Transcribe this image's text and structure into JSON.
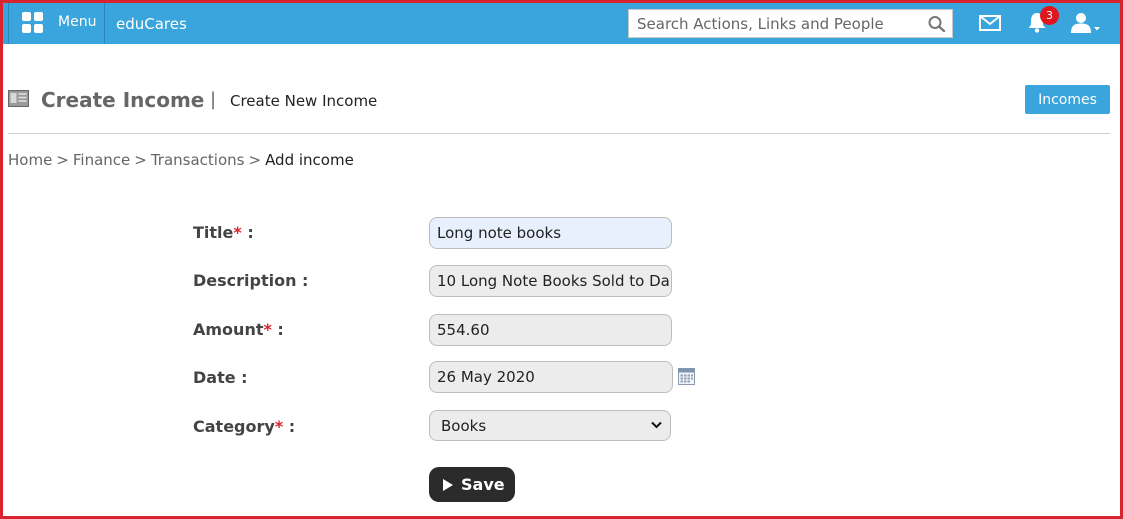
{
  "app": {
    "menu_label": "Menu",
    "brand": "eduCares",
    "search_placeholder": "Search Actions, Links and People",
    "notification_count": "3",
    "accent_color": "#3aa4dc",
    "badge_color": "#e0161d",
    "icons": [
      "menu-grid-icon",
      "search-icon",
      "mail-icon",
      "bell-icon",
      "user-icon",
      "chevron-down-icon",
      "receipt-icon",
      "calendar-icon",
      "play-icon"
    ]
  },
  "header": {
    "title": "Create Income",
    "separator": "|",
    "subtitle": "Create New Income",
    "incomes_button": "Incomes"
  },
  "breadcrumb": {
    "items": [
      "Home",
      "Finance",
      "Transactions"
    ],
    "current": "Add income",
    "separator": ">"
  },
  "form": {
    "required_mark": "*",
    "title_label": "Title",
    "title_value": "Long note books",
    "description_label": "Description :",
    "description_value": "10 Long Note Books Sold to Da",
    "amount_label": "Amount",
    "amount_value": "554.60",
    "date_label": "Date :",
    "date_value": "26 May 2020",
    "category_label": "Category",
    "category_value": "Books",
    "label_colon": " :",
    "save_label": "Save"
  }
}
